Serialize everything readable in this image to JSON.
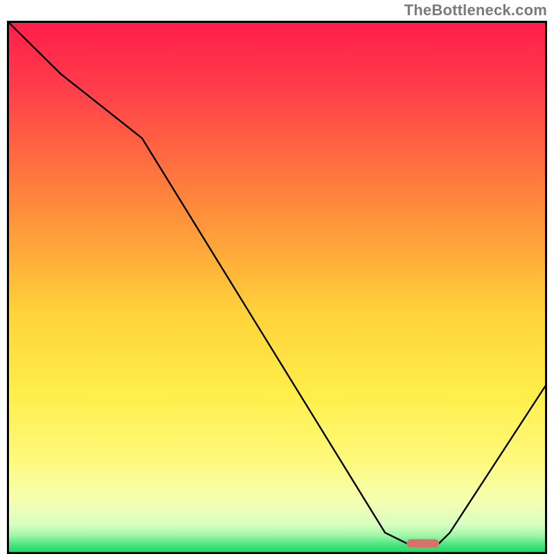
{
  "watermark": "TheBottleneck.com",
  "chart_data": {
    "type": "line",
    "title": "",
    "xlabel": "",
    "ylabel": "",
    "xlim": [
      0,
      100
    ],
    "ylim": [
      0,
      100
    ],
    "series": [
      {
        "name": "bottleneck-curve",
        "x": [
          0,
          10,
          25,
          70,
          74,
          80,
          82,
          100
        ],
        "values": [
          100,
          90,
          78,
          4,
          2,
          2,
          4,
          32
        ]
      }
    ],
    "marker": {
      "name": "optimal-segment",
      "x_start": 74,
      "x_end": 80,
      "y": 2,
      "color": "#d9716a"
    },
    "background_gradient": {
      "stops": [
        {
          "offset": 0.0,
          "color": "#ff1e4a"
        },
        {
          "offset": 0.12,
          "color": "#ff3b4a"
        },
        {
          "offset": 0.35,
          "color": "#ff8b3a"
        },
        {
          "offset": 0.55,
          "color": "#ffd33a"
        },
        {
          "offset": 0.7,
          "color": "#ffee4a"
        },
        {
          "offset": 0.82,
          "color": "#fff97a"
        },
        {
          "offset": 0.9,
          "color": "#f6ffb0"
        },
        {
          "offset": 0.945,
          "color": "#d7ffc0"
        },
        {
          "offset": 0.965,
          "color": "#a0f7a8"
        },
        {
          "offset": 0.985,
          "color": "#3fe27a"
        },
        {
          "offset": 1.0,
          "color": "#14d66a"
        }
      ]
    },
    "frame_color": "#000000",
    "curve_color": "#000000"
  }
}
